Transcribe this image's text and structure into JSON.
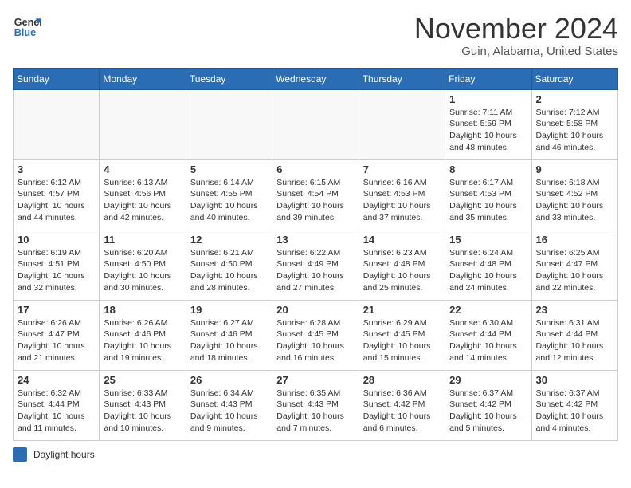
{
  "header": {
    "logo_line1": "General",
    "logo_line2": "Blue",
    "month": "November 2024",
    "location": "Guin, Alabama, United States"
  },
  "weekdays": [
    "Sunday",
    "Monday",
    "Tuesday",
    "Wednesday",
    "Thursday",
    "Friday",
    "Saturday"
  ],
  "weeks": [
    [
      {
        "day": "",
        "info": ""
      },
      {
        "day": "",
        "info": ""
      },
      {
        "day": "",
        "info": ""
      },
      {
        "day": "",
        "info": ""
      },
      {
        "day": "",
        "info": ""
      },
      {
        "day": "1",
        "info": "Sunrise: 7:11 AM\nSunset: 5:59 PM\nDaylight: 10 hours and 48 minutes."
      },
      {
        "day": "2",
        "info": "Sunrise: 7:12 AM\nSunset: 5:58 PM\nDaylight: 10 hours and 46 minutes."
      }
    ],
    [
      {
        "day": "3",
        "info": "Sunrise: 6:12 AM\nSunset: 4:57 PM\nDaylight: 10 hours and 44 minutes."
      },
      {
        "day": "4",
        "info": "Sunrise: 6:13 AM\nSunset: 4:56 PM\nDaylight: 10 hours and 42 minutes."
      },
      {
        "day": "5",
        "info": "Sunrise: 6:14 AM\nSunset: 4:55 PM\nDaylight: 10 hours and 40 minutes."
      },
      {
        "day": "6",
        "info": "Sunrise: 6:15 AM\nSunset: 4:54 PM\nDaylight: 10 hours and 39 minutes."
      },
      {
        "day": "7",
        "info": "Sunrise: 6:16 AM\nSunset: 4:53 PM\nDaylight: 10 hours and 37 minutes."
      },
      {
        "day": "8",
        "info": "Sunrise: 6:17 AM\nSunset: 4:53 PM\nDaylight: 10 hours and 35 minutes."
      },
      {
        "day": "9",
        "info": "Sunrise: 6:18 AM\nSunset: 4:52 PM\nDaylight: 10 hours and 33 minutes."
      }
    ],
    [
      {
        "day": "10",
        "info": "Sunrise: 6:19 AM\nSunset: 4:51 PM\nDaylight: 10 hours and 32 minutes."
      },
      {
        "day": "11",
        "info": "Sunrise: 6:20 AM\nSunset: 4:50 PM\nDaylight: 10 hours and 30 minutes."
      },
      {
        "day": "12",
        "info": "Sunrise: 6:21 AM\nSunset: 4:50 PM\nDaylight: 10 hours and 28 minutes."
      },
      {
        "day": "13",
        "info": "Sunrise: 6:22 AM\nSunset: 4:49 PM\nDaylight: 10 hours and 27 minutes."
      },
      {
        "day": "14",
        "info": "Sunrise: 6:23 AM\nSunset: 4:48 PM\nDaylight: 10 hours and 25 minutes."
      },
      {
        "day": "15",
        "info": "Sunrise: 6:24 AM\nSunset: 4:48 PM\nDaylight: 10 hours and 24 minutes."
      },
      {
        "day": "16",
        "info": "Sunrise: 6:25 AM\nSunset: 4:47 PM\nDaylight: 10 hours and 22 minutes."
      }
    ],
    [
      {
        "day": "17",
        "info": "Sunrise: 6:26 AM\nSunset: 4:47 PM\nDaylight: 10 hours and 21 minutes."
      },
      {
        "day": "18",
        "info": "Sunrise: 6:26 AM\nSunset: 4:46 PM\nDaylight: 10 hours and 19 minutes."
      },
      {
        "day": "19",
        "info": "Sunrise: 6:27 AM\nSunset: 4:46 PM\nDaylight: 10 hours and 18 minutes."
      },
      {
        "day": "20",
        "info": "Sunrise: 6:28 AM\nSunset: 4:45 PM\nDaylight: 10 hours and 16 minutes."
      },
      {
        "day": "21",
        "info": "Sunrise: 6:29 AM\nSunset: 4:45 PM\nDaylight: 10 hours and 15 minutes."
      },
      {
        "day": "22",
        "info": "Sunrise: 6:30 AM\nSunset: 4:44 PM\nDaylight: 10 hours and 14 minutes."
      },
      {
        "day": "23",
        "info": "Sunrise: 6:31 AM\nSunset: 4:44 PM\nDaylight: 10 hours and 12 minutes."
      }
    ],
    [
      {
        "day": "24",
        "info": "Sunrise: 6:32 AM\nSunset: 4:44 PM\nDaylight: 10 hours and 11 minutes."
      },
      {
        "day": "25",
        "info": "Sunrise: 6:33 AM\nSunset: 4:43 PM\nDaylight: 10 hours and 10 minutes."
      },
      {
        "day": "26",
        "info": "Sunrise: 6:34 AM\nSunset: 4:43 PM\nDaylight: 10 hours and 9 minutes."
      },
      {
        "day": "27",
        "info": "Sunrise: 6:35 AM\nSunset: 4:43 PM\nDaylight: 10 hours and 7 minutes."
      },
      {
        "day": "28",
        "info": "Sunrise: 6:36 AM\nSunset: 4:42 PM\nDaylight: 10 hours and 6 minutes."
      },
      {
        "day": "29",
        "info": "Sunrise: 6:37 AM\nSunset: 4:42 PM\nDaylight: 10 hours and 5 minutes."
      },
      {
        "day": "30",
        "info": "Sunrise: 6:37 AM\nSunset: 4:42 PM\nDaylight: 10 hours and 4 minutes."
      }
    ]
  ],
  "footer": {
    "legend_label": "Daylight hours"
  }
}
